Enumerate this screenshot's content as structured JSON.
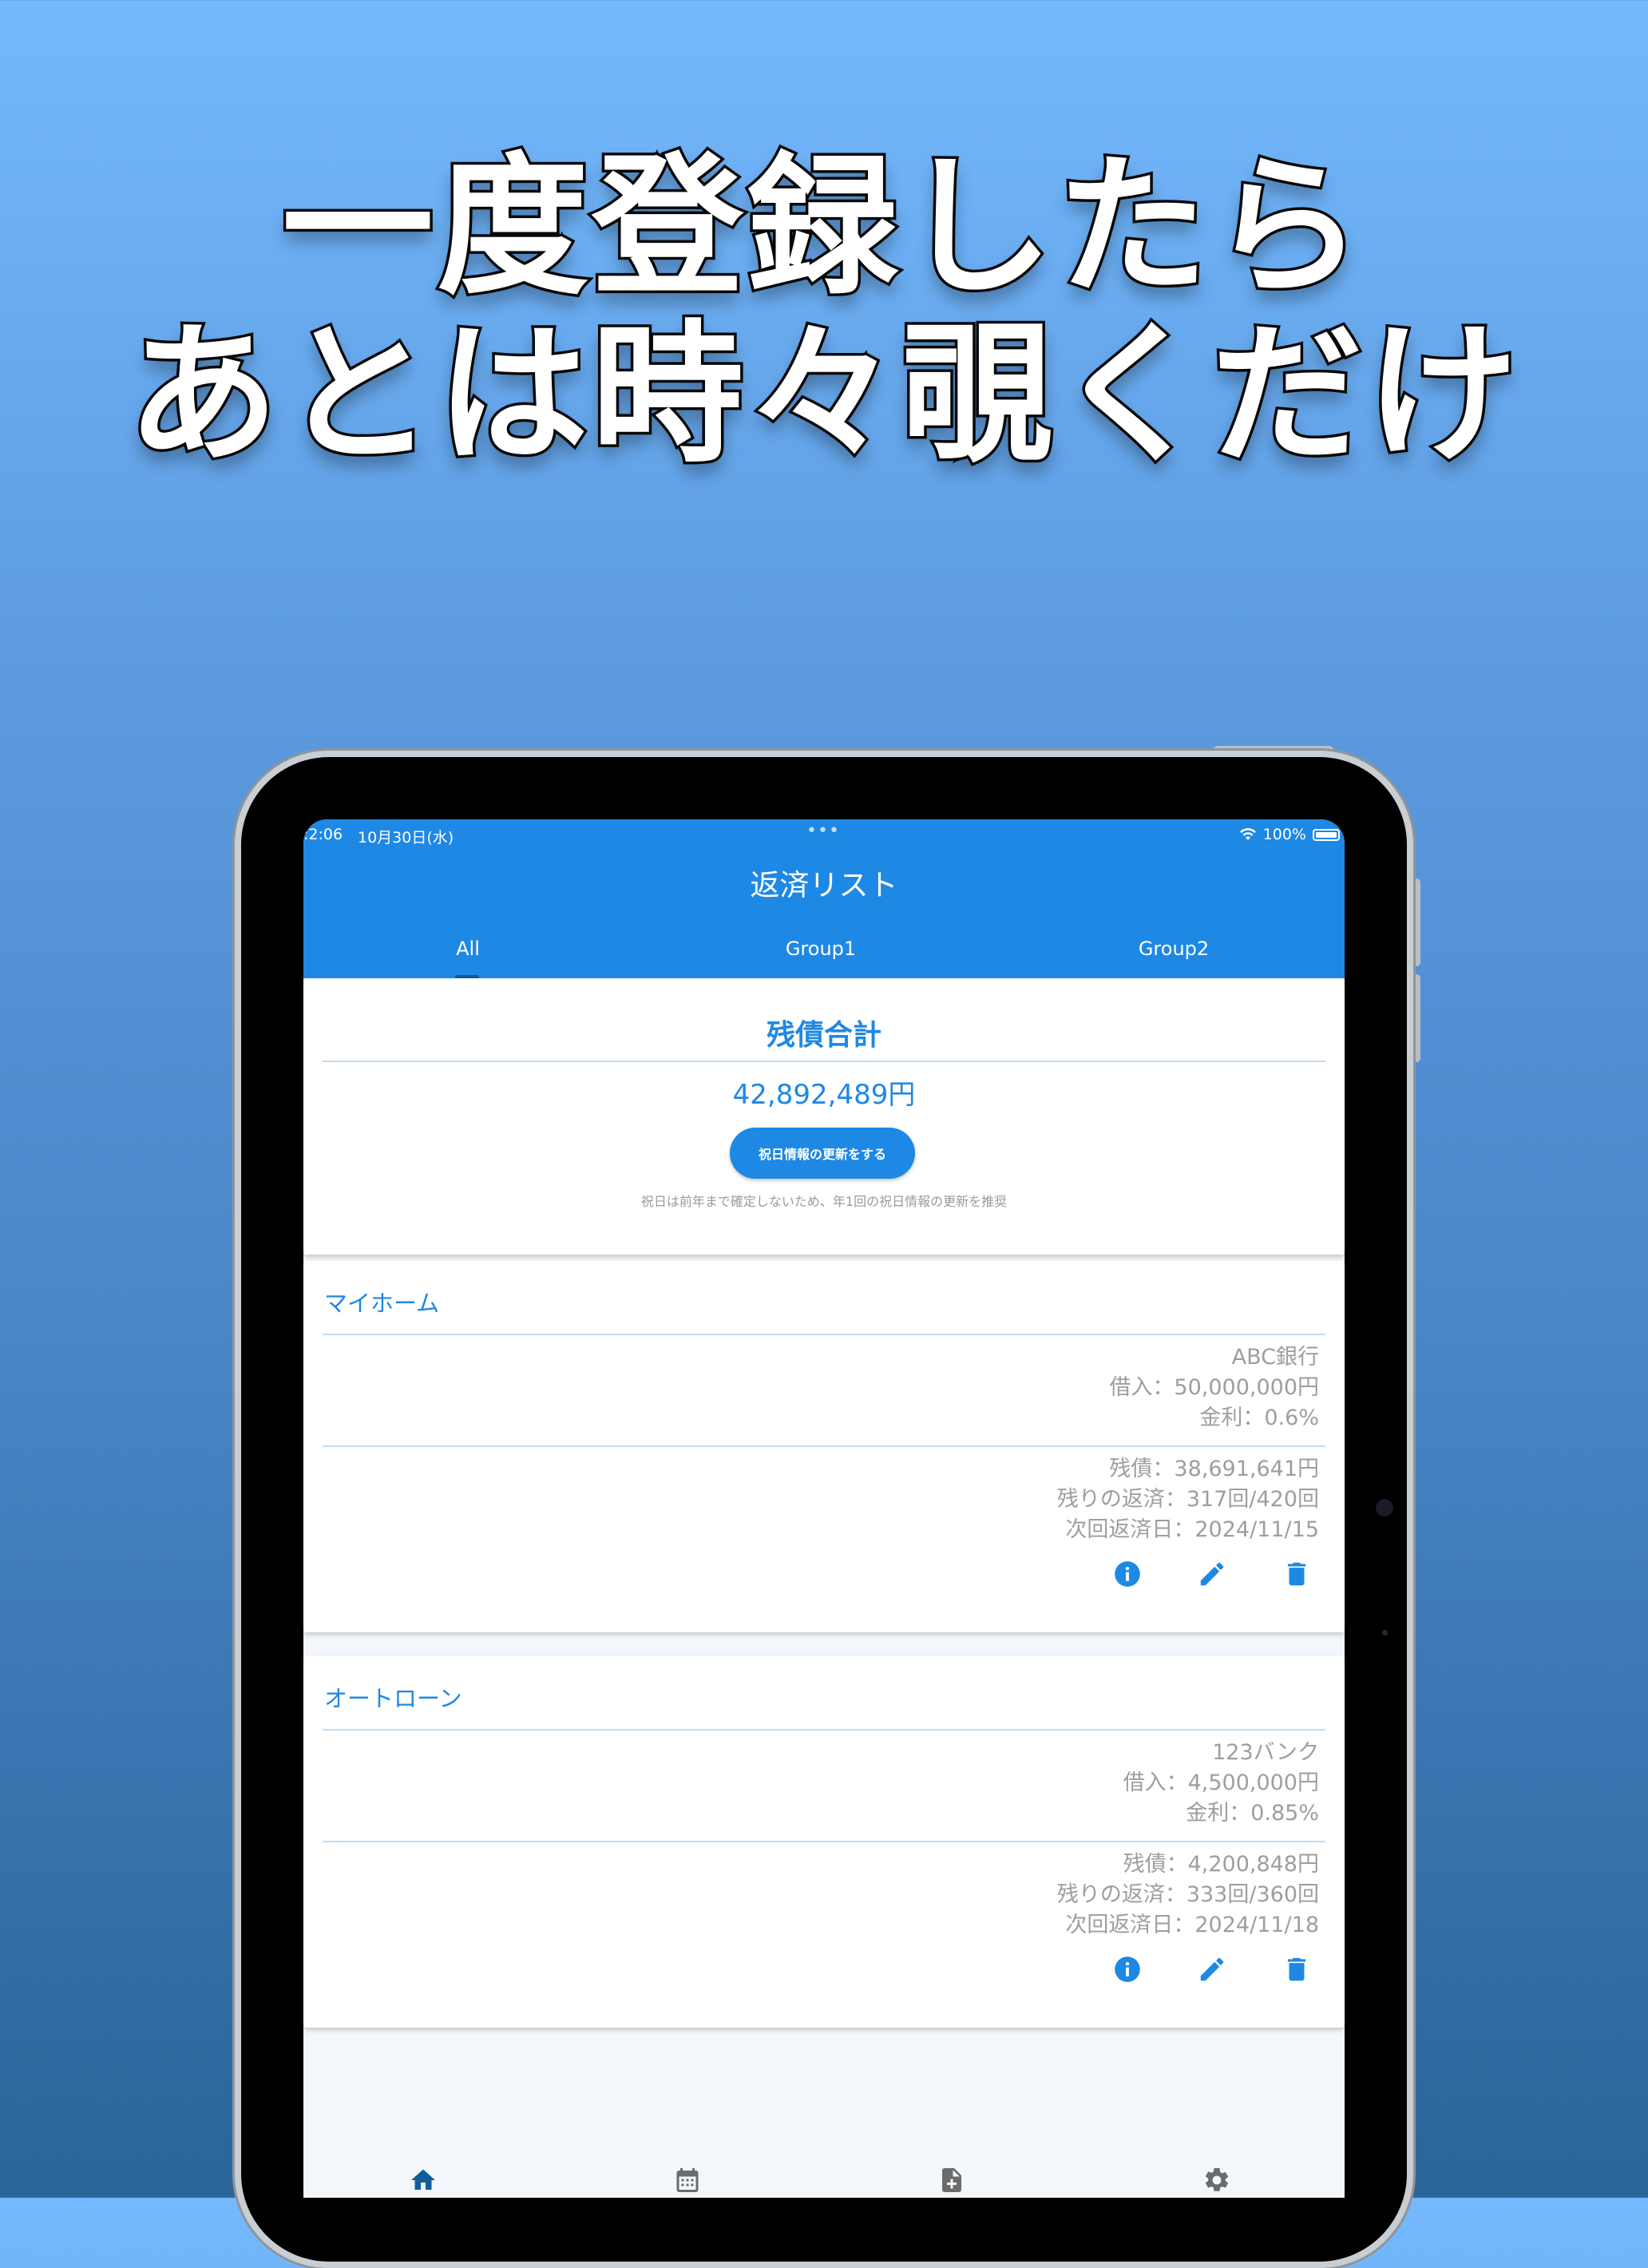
{
  "headline": {
    "line1": "一度登録したら",
    "line2": "あとは時々覗くだけ"
  },
  "status": {
    "time": ":2:06",
    "date": "10月30日(水)",
    "dots": "•••",
    "battery": "100%"
  },
  "appbar": {
    "title": "返済リスト"
  },
  "tabs": [
    {
      "label": "All"
    },
    {
      "label": "Group1"
    },
    {
      "label": "Group2"
    }
  ],
  "summary": {
    "title": "残債合計",
    "amount": "42,892,489円",
    "button_label": "祝日情報の更新をする",
    "note": "祝日は前年まで確定しないため、年1回の祝日情報の更新を推奨"
  },
  "loans": [
    {
      "name": "マイホーム",
      "bank": "ABC銀行",
      "borrowed": "借入：50,000,000円",
      "rate": "金利：0.6%",
      "remaining": "残債：38,691,641円",
      "payments_left": "残りの返済：317回/420回",
      "next_date": "次回返済日：2024/11/15"
    },
    {
      "name": "オートローン",
      "bank": "123バンク",
      "borrowed": "借入：4,500,000円",
      "rate": "金利：0.85%",
      "remaining": "残債：4,200,848円",
      "payments_left": "残りの返済：333回/360回",
      "next_date": "次回返済日：2024/11/18"
    }
  ],
  "icons": {
    "info": "info-icon",
    "edit": "edit-icon",
    "delete": "delete-icon",
    "home": "home-icon",
    "calendar": "calendar-icon",
    "add_file": "add-file-icon",
    "settings": "settings-icon"
  },
  "colors": {
    "primary": "#1e88e5",
    "nav_active": "#105d9b",
    "nav_inactive": "#6b6b6b",
    "muted_text": "#9e9e9e"
  }
}
